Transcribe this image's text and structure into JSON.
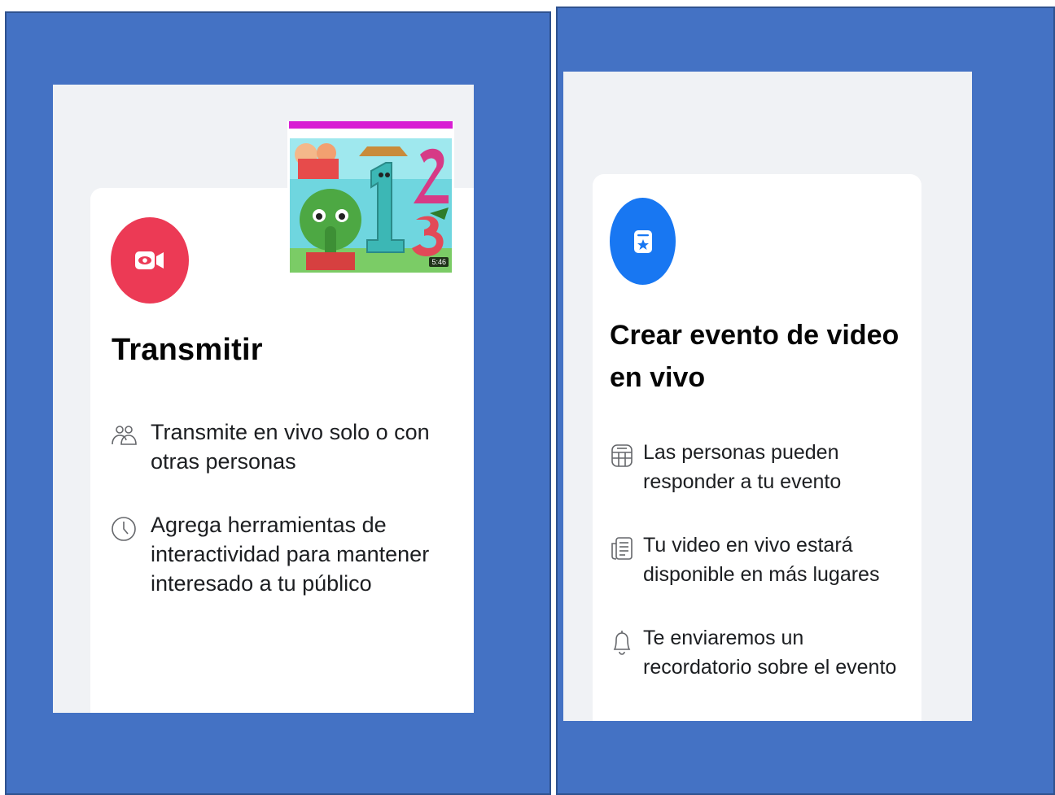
{
  "left_card": {
    "title": "Transmitir",
    "icon": "live-video-camera-icon",
    "icon_color": "#ec3a55",
    "features": [
      {
        "icon": "people-icon",
        "text": "Transmite en vivo solo o con otras personas"
      },
      {
        "icon": "clock-icon",
        "text": "Agrega herramientas de interactividad para mantener interesado a tu público"
      }
    ],
    "thumbnail": {
      "duration": "5:46"
    }
  },
  "right_card": {
    "title": "Crear evento de video en vivo",
    "icon": "calendar-star-icon",
    "icon_color": "#1877f2",
    "features": [
      {
        "icon": "calendar-icon",
        "text": "Las personas pueden responder a tu evento"
      },
      {
        "icon": "feed-icon",
        "text": "Tu video en vivo estará disponible en más lugares"
      },
      {
        "icon": "bell-icon",
        "text": "Te enviaremos un recordatorio sobre el evento"
      }
    ]
  },
  "colors": {
    "panel_background": "#4472c4",
    "screen_background": "#f0f2f5",
    "card_background": "#ffffff"
  }
}
